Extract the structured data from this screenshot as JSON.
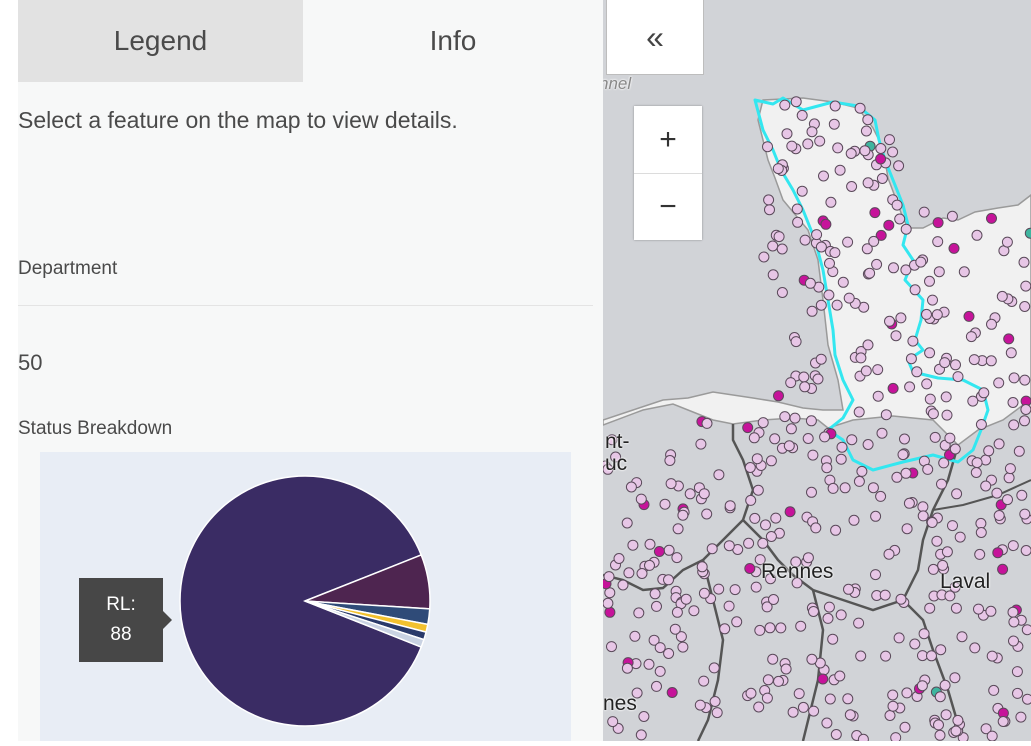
{
  "tabs": {
    "legend": "Legend",
    "info": "Info"
  },
  "info": {
    "description": "Select a feature on the map to view details.",
    "field_label": "Department",
    "field_value": "50",
    "section_title": "Status Breakdown"
  },
  "chart_data": {
    "type": "pie",
    "slices": [
      {
        "label": "RL",
        "value": 88,
        "color": "#3a2c64"
      },
      {
        "label": "",
        "value": 7,
        "color": "#4e2550"
      },
      {
        "label": "",
        "value": 2,
        "color": "#2f4b78"
      },
      {
        "label": "",
        "value": 1,
        "color": "#f2c12e"
      },
      {
        "label": "",
        "value": 1,
        "color": "#2a3a6a"
      },
      {
        "label": "",
        "value": 1,
        "color": "#c9d2e2"
      }
    ]
  },
  "tooltip": {
    "label": "RL:",
    "value": "88"
  },
  "controls": {
    "collapse": "«",
    "zoom_in": "+",
    "zoom_out": "−"
  },
  "map": {
    "labels": {
      "rennes": "Rennes",
      "laval": "Laval",
      "fragment_tl": "nnel",
      "fragment_left1": "nt-",
      "fragment_left2": "uc",
      "fragment_bottom": "nes"
    },
    "colors": {
      "sea": "#d1d3d7",
      "land": "#f1f1f1",
      "highlight": "#33e7f0",
      "point_light": "#e7c6e6",
      "point_dark": "#c6139a",
      "point_red": "#e2211b",
      "point_teal": "#3fb59f"
    }
  }
}
